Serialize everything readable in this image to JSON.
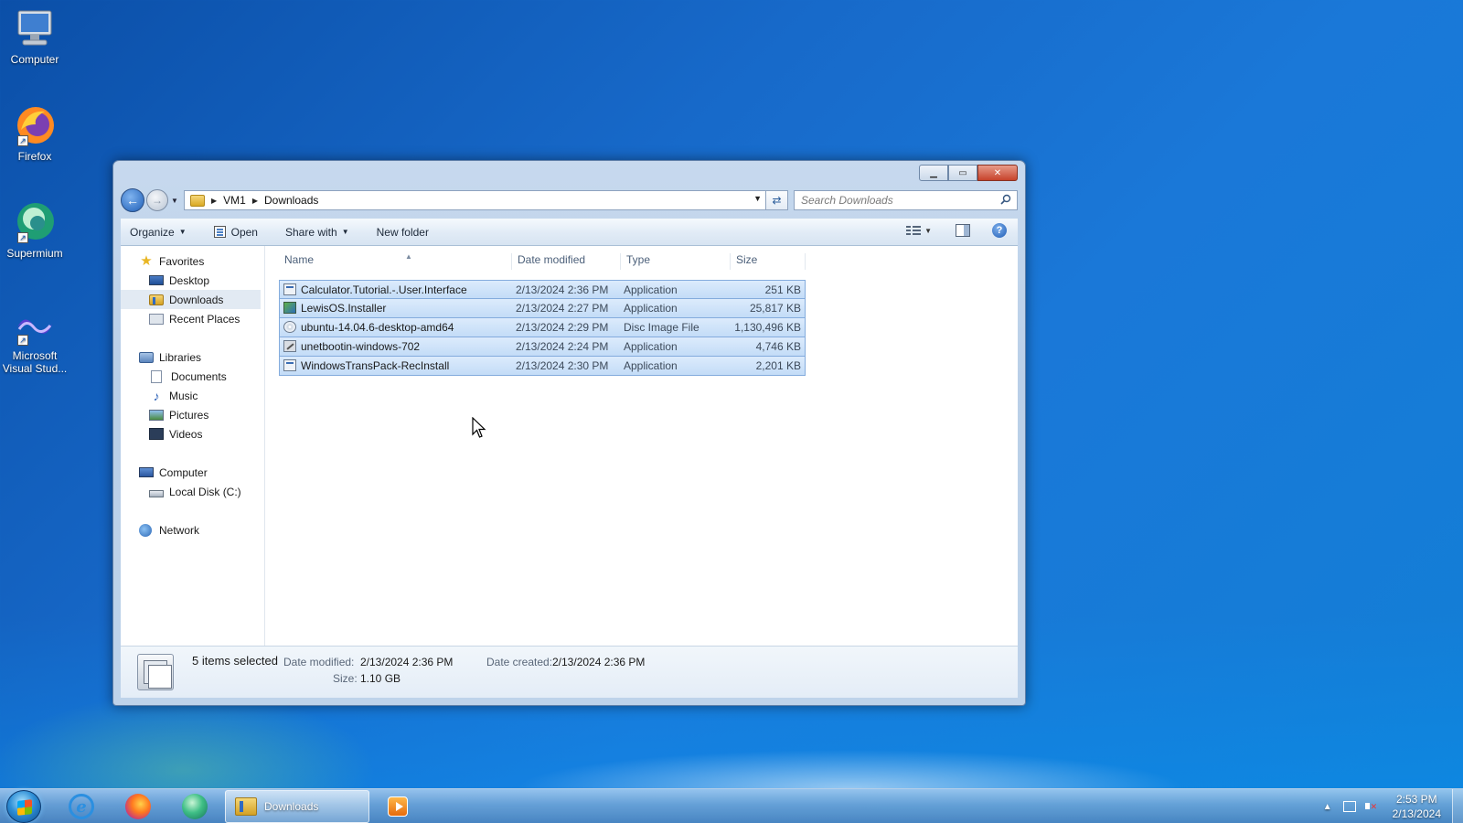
{
  "desktop": {
    "icons": [
      {
        "label": "Computer",
        "icon": "computer-icon"
      },
      {
        "label": "Firefox",
        "icon": "firefox-icon"
      },
      {
        "label": "Supermium",
        "icon": "supermium-icon"
      },
      {
        "label": "Microsoft Visual Stud...",
        "label_line1": "Microsoft",
        "label_line2": "Visual Stud...",
        "icon": "visual-studio-icon"
      }
    ]
  },
  "window": {
    "caption_buttons": {
      "minimize": "minimize",
      "maximize": "maximize",
      "close": "close"
    },
    "address": {
      "crumbs": [
        "VM1",
        "Downloads"
      ]
    },
    "search": {
      "placeholder": "Search Downloads"
    },
    "toolbar": {
      "organize": "Organize",
      "open": "Open",
      "share_with": "Share with",
      "new_folder": "New folder"
    },
    "nav": {
      "favorites": "Favorites",
      "favorites_items": [
        "Desktop",
        "Downloads",
        "Recent Places"
      ],
      "libraries": "Libraries",
      "libraries_items": [
        "Documents",
        "Music",
        "Pictures",
        "Videos"
      ],
      "computer": "Computer",
      "computer_items": [
        "Local Disk (C:)"
      ],
      "network": "Network"
    },
    "columns": {
      "name": "Name",
      "date_modified": "Date modified",
      "type": "Type",
      "size": "Size"
    },
    "files": [
      {
        "name": "Calculator.Tutorial.-.User.Interface",
        "date": "2/13/2024 2:36 PM",
        "type": "Application",
        "size": "251 KB",
        "icon": "application-icon"
      },
      {
        "name": "LewisOS.Installer",
        "date": "2/13/2024 2:27 PM",
        "type": "Application",
        "size": "25,817 KB",
        "icon": "installer-icon"
      },
      {
        "name": "ubuntu-14.04.6-desktop-amd64",
        "date": "2/13/2024 2:29 PM",
        "type": "Disc Image File",
        "size": "1,130,496 KB",
        "icon": "disc-image-icon"
      },
      {
        "name": "unetbootin-windows-702",
        "date": "2/13/2024 2:24 PM",
        "type": "Application",
        "size": "4,746 KB",
        "icon": "wrench-app-icon"
      },
      {
        "name": "WindowsTransPack-RecInstall",
        "date": "2/13/2024 2:30 PM",
        "type": "Application",
        "size": "2,201 KB",
        "icon": "application-icon"
      }
    ],
    "details": {
      "count": "5 items selected",
      "date_modified_label": "Date modified:",
      "date_modified_value": "2/13/2024 2:36 PM",
      "date_created_label": "Date created:",
      "date_created_value": "2/13/2024 2:36 PM",
      "size_label": "Size:",
      "size_value": "1.10 GB"
    }
  },
  "taskbar": {
    "downloads_label": "Downloads",
    "clock_time": "2:53 PM",
    "clock_date": "2/13/2024"
  }
}
